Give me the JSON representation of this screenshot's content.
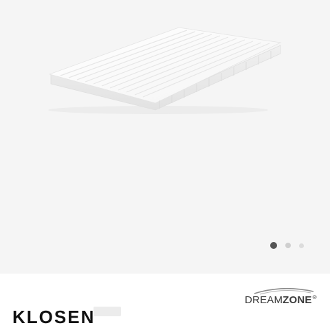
{
  "gallery": {
    "image_alt": "Mattress topper",
    "background_color": "#f5f5f5",
    "pagination": {
      "total": 3,
      "active_index": 1
    }
  },
  "brand": {
    "name_light": "DREAM",
    "name_bold": "ZONE",
    "registered": "®"
  },
  "product": {
    "title": "KLOSEN"
  }
}
